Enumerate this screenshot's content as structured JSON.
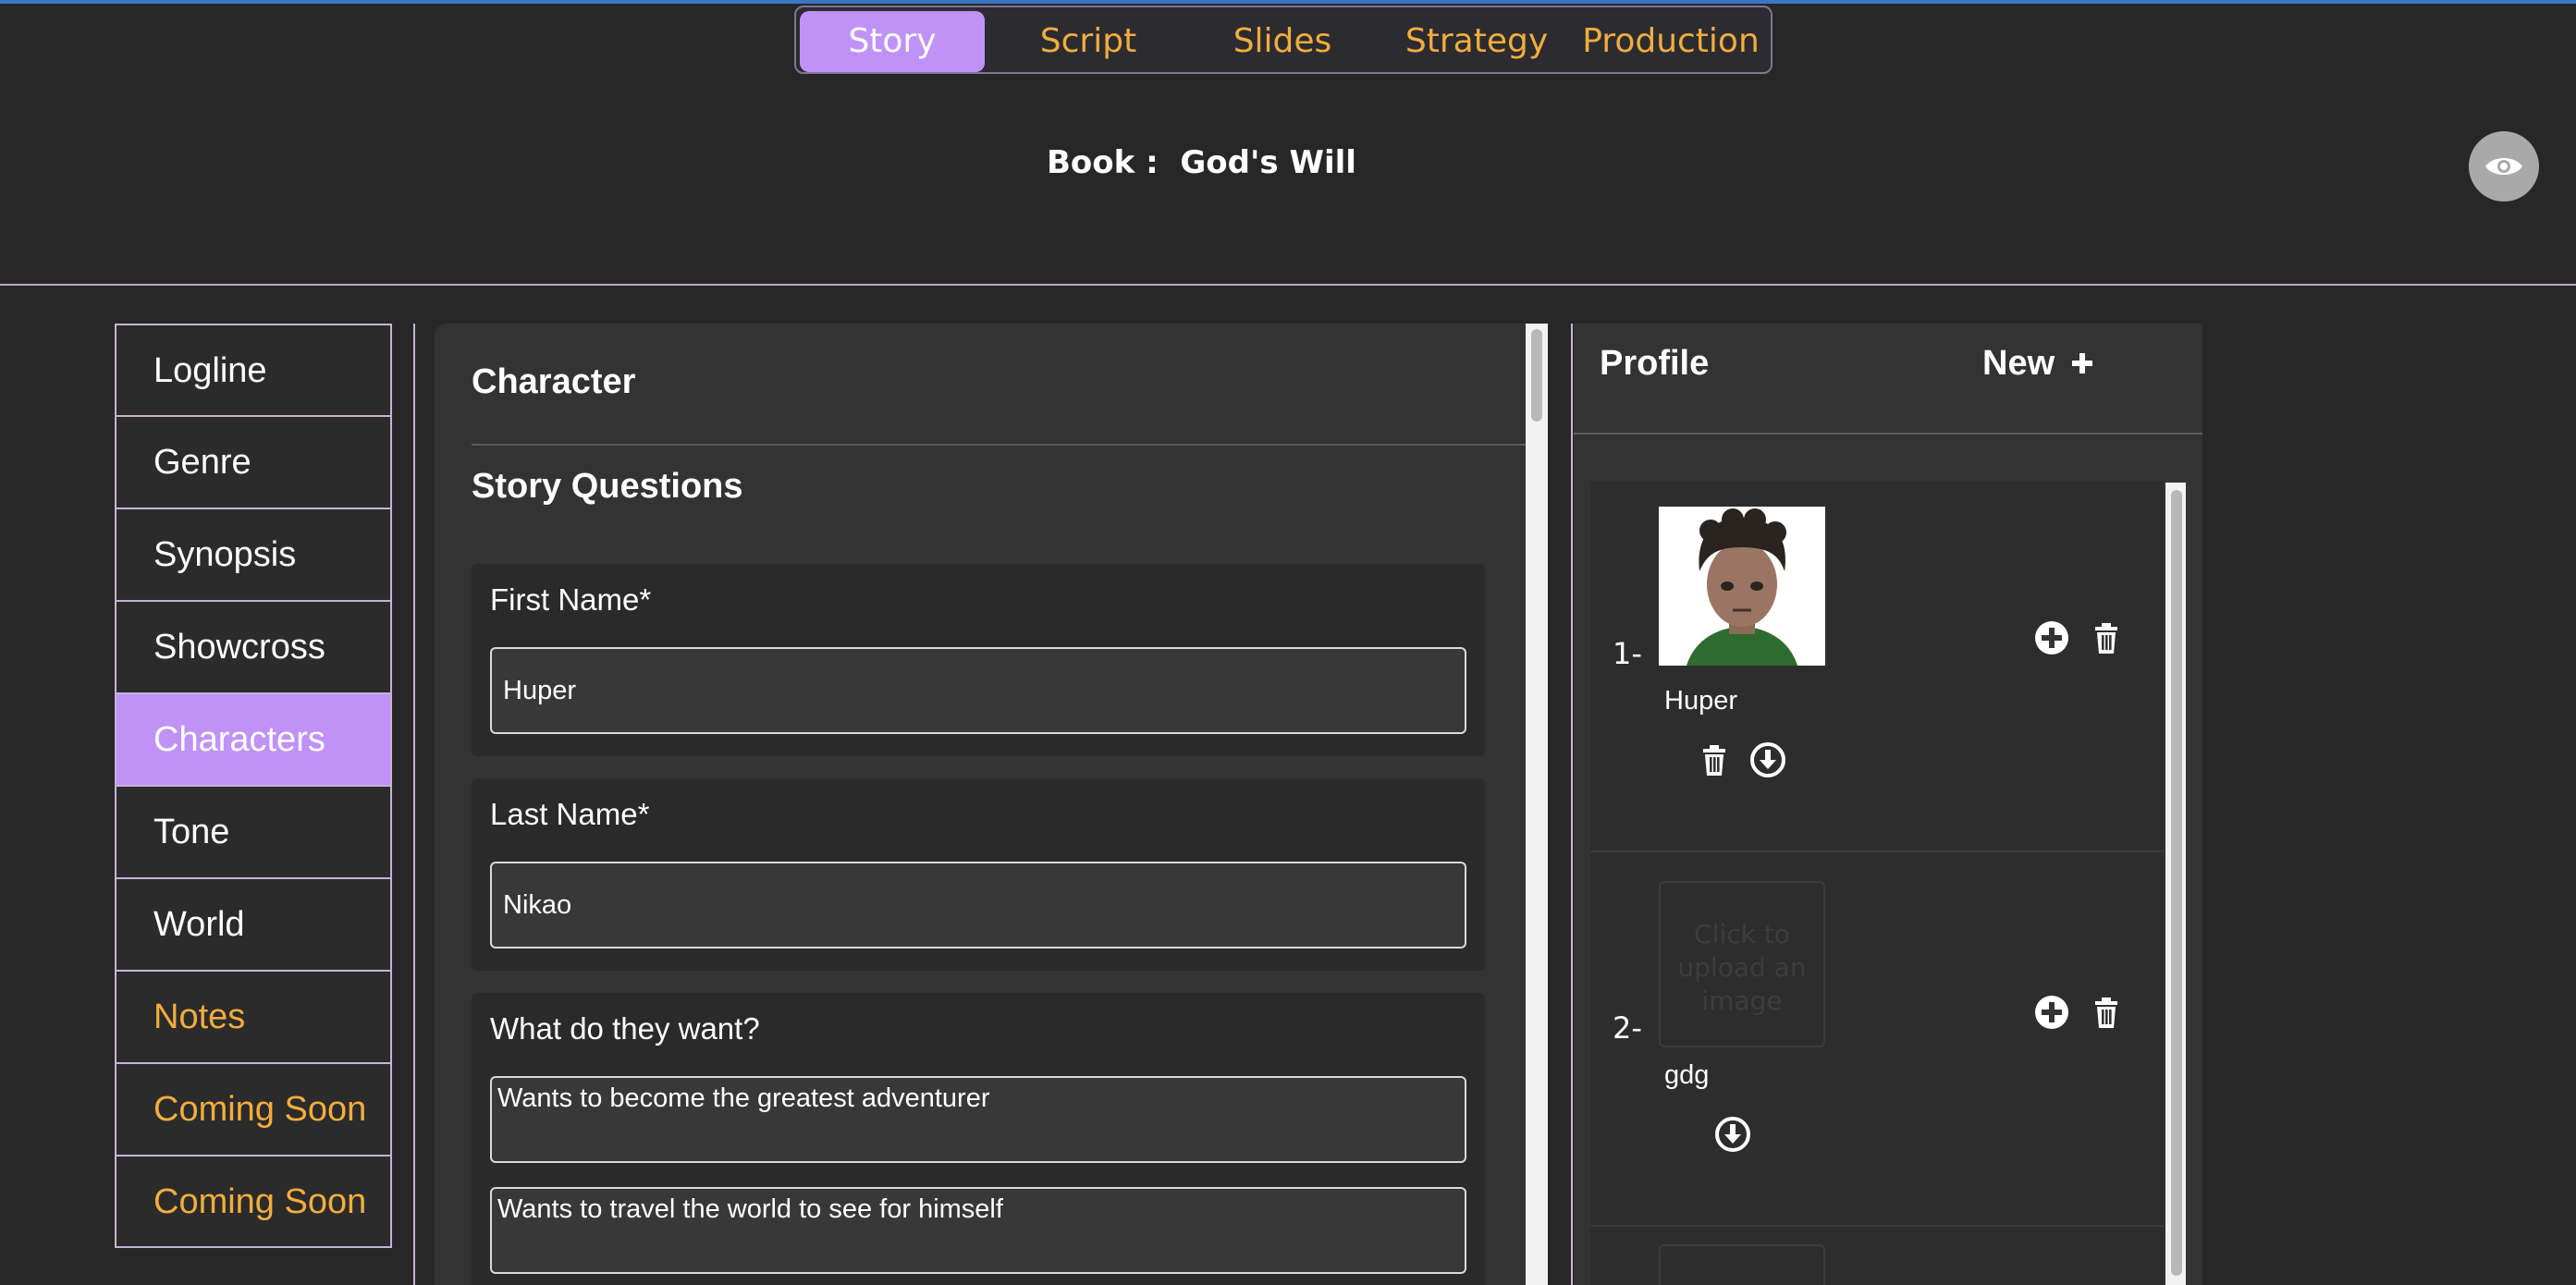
{
  "nav": {
    "tabs": [
      {
        "label": "Story",
        "active": true
      },
      {
        "label": "Script",
        "active": false
      },
      {
        "label": "Slides",
        "active": false
      },
      {
        "label": "Strategy",
        "active": false
      },
      {
        "label": "Production",
        "active": false
      }
    ]
  },
  "book": {
    "prefix": "Book :",
    "title": "God's Will"
  },
  "sidebar": {
    "items": [
      {
        "label": "Logline"
      },
      {
        "label": "Genre"
      },
      {
        "label": "Synopsis"
      },
      {
        "label": "Showcross"
      },
      {
        "label": "Characters"
      },
      {
        "label": "Tone"
      },
      {
        "label": "World"
      },
      {
        "label": "Notes"
      },
      {
        "label": "Coming Soon"
      },
      {
        "label": "Coming Soon"
      }
    ]
  },
  "form": {
    "heading": "Character",
    "subheading": "Story Questions",
    "first_name": {
      "label": "First Name*",
      "value": "Huper"
    },
    "last_name": {
      "label": "Last Name*",
      "value": "Nikao"
    },
    "wants": {
      "label": "What do they want?",
      "answers": [
        "Wants to become the greatest adventurer",
        "Wants to travel the world to see for himself"
      ]
    }
  },
  "profile": {
    "title": "Profile",
    "new_label": "New",
    "entries": [
      {
        "number": "1-",
        "name": "Huper"
      },
      {
        "number": "2-",
        "name": "gdg",
        "upload_text": "Click to upload an image"
      }
    ]
  },
  "colors": {
    "accent": "#c092f8",
    "highlight": "#f1ad3d",
    "background": "#272727"
  }
}
